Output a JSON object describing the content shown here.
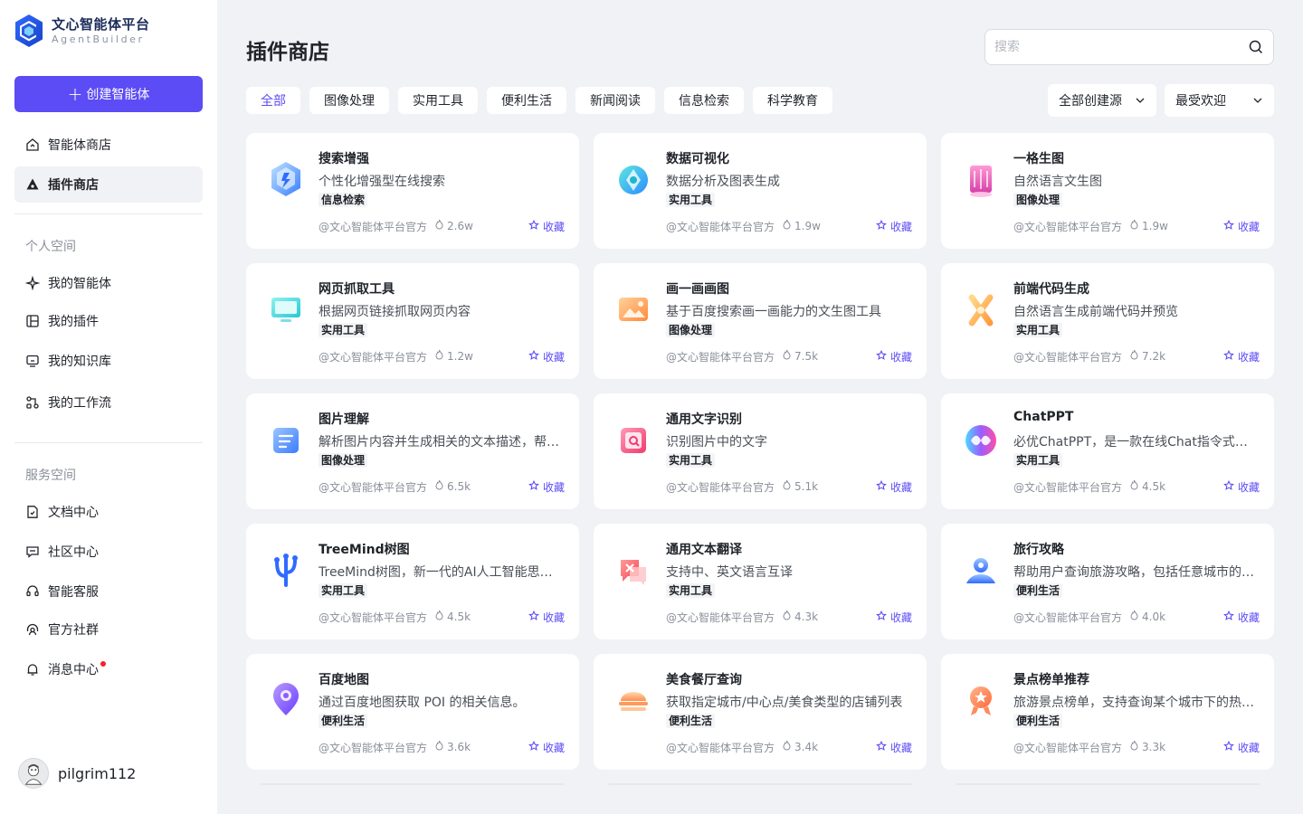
{
  "brand": {
    "title": "文心智能体平台",
    "subtitle": "AgentBuilder"
  },
  "sidebar": {
    "create_label": "创建智能体",
    "top_items": [
      {
        "label": "智能体商店",
        "icon": "home-icon"
      },
      {
        "label": "插件商店",
        "icon": "plugin-store-icon",
        "active": true
      }
    ],
    "personal_title": "个人空间",
    "personal_items": [
      {
        "label": "我的智能体",
        "icon": "sparkle-icon"
      },
      {
        "label": "我的插件",
        "icon": "plugin-icon"
      },
      {
        "label": "我的知识库",
        "icon": "monitor-icon"
      },
      {
        "label": "我的工作流",
        "icon": "workflow-icon"
      }
    ],
    "service_title": "服务空间",
    "service_items": [
      {
        "label": "文档中心",
        "icon": "document-icon"
      },
      {
        "label": "社区中心",
        "icon": "chat-icon"
      },
      {
        "label": "智能客服",
        "icon": "headset-icon"
      },
      {
        "label": "官方社群",
        "icon": "group-icon"
      },
      {
        "label": "消息中心",
        "icon": "bell-icon",
        "has_dot": true
      }
    ],
    "user": {
      "name": "pilgrim112"
    }
  },
  "header": {
    "title": "插件商店",
    "search_placeholder": "搜索"
  },
  "tabs": [
    "全部",
    "图像处理",
    "实用工具",
    "便利生活",
    "新闻阅读",
    "信息检索",
    "科学教育"
  ],
  "filters": {
    "source": "全部创建源",
    "sort": "最受欢迎"
  },
  "accent_color": "#5c4cf5",
  "fav_label": "收藏",
  "cards": [
    {
      "title": "搜索增强",
      "desc": "个性化增强型在线搜索",
      "tag": "信息检索",
      "author": "@文心智能体平台官方",
      "heat": "2.6w",
      "icon": "search-enhance-icon"
    },
    {
      "title": "数据可视化",
      "desc": "数据分析及图表生成",
      "tag": "实用工具",
      "author": "@文心智能体平台官方",
      "heat": "1.9w",
      "icon": "data-viz-icon"
    },
    {
      "title": "一格生图",
      "desc": "自然语言文生图",
      "tag": "图像处理",
      "author": "@文心智能体平台官方",
      "heat": "1.9w",
      "icon": "image-gen-icon"
    },
    {
      "title": "网页抓取工具",
      "desc": "根据网页链接抓取网页内容",
      "tag": "实用工具",
      "author": "@文心智能体平台官方",
      "heat": "1.2w",
      "icon": "web-crawl-icon"
    },
    {
      "title": "画一画画图",
      "desc": "基于百度搜索画一画能力的文生图工具",
      "tag": "图像处理",
      "author": "@文心智能体平台官方",
      "heat": "7.5k",
      "icon": "paint-icon"
    },
    {
      "title": "前端代码生成",
      "desc": "自然语言生成前端代码并预览",
      "tag": "实用工具",
      "author": "@文心智能体平台官方",
      "heat": "7.2k",
      "icon": "code-gen-icon"
    },
    {
      "title": "图片理解",
      "desc": "解析图片内容并生成相关的文本描述，帮助用户理解图片",
      "tag": "图像处理",
      "author": "@文心智能体平台官方",
      "heat": "6.5k",
      "icon": "image-understand-icon"
    },
    {
      "title": "通用文字识别",
      "desc": "识别图片中的文字",
      "tag": "实用工具",
      "author": "@文心智能体平台官方",
      "heat": "5.1k",
      "icon": "ocr-icon"
    },
    {
      "title": "ChatPPT",
      "desc": "必优ChatPPT，是一款在线Chat指令式生成PPT的工具",
      "tag": "实用工具",
      "author": "@文心智能体平台官方",
      "heat": "4.5k",
      "icon": "chatppt-icon"
    },
    {
      "title": "TreeMind树图",
      "desc": "TreeMind树图，新一代的AI人工智能思维导图工具",
      "tag": "实用工具",
      "author": "@文心智能体平台官方",
      "heat": "4.5k",
      "icon": "treemind-icon"
    },
    {
      "title": "通用文本翻译",
      "desc": "支持中、英文语言互译",
      "tag": "实用工具",
      "author": "@文心智能体平台官方",
      "heat": "4.3k",
      "icon": "translate-icon"
    },
    {
      "title": "旅行攻略",
      "desc": "帮助用户查询旅游攻略，包括任意城市的景点和美食",
      "tag": "便利生活",
      "author": "@文心智能体平台官方",
      "heat": "4.0k",
      "icon": "travel-icon"
    },
    {
      "title": "百度地图",
      "desc": "通过百度地图获取 POI 的相关信息。",
      "tag": "便利生活",
      "author": "@文心智能体平台官方",
      "heat": "3.6k",
      "icon": "map-pin-icon"
    },
    {
      "title": "美食餐厅查询",
      "desc": "获取指定城市/中心点/美食类型的店铺列表",
      "tag": "便利生活",
      "author": "@文心智能体平台官方",
      "heat": "3.4k",
      "icon": "food-icon"
    },
    {
      "title": "景点榜单推荐",
      "desc": "旅游景点榜单，支持查询某个城市下的热门景点",
      "tag": "便利生活",
      "author": "@文心智能体平台官方",
      "heat": "3.3k",
      "icon": "attraction-icon"
    }
  ]
}
